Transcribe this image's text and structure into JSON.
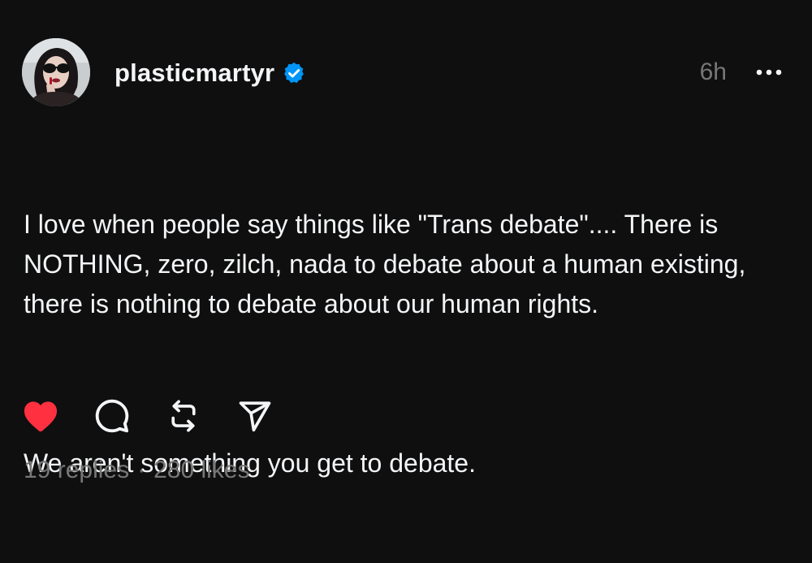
{
  "post": {
    "author": {
      "username": "plasticmartyr",
      "verified": true,
      "verified_color": "#0095f6"
    },
    "timestamp": "6h",
    "text": [
      "I love when people say things like \"Trans debate\".... There is NOTHING, zero, zilch, nada to debate about a human existing, there is nothing to debate about our human rights.",
      "We aren't something you get to debate."
    ],
    "liked": true,
    "like_color": "#ff3040",
    "stats": {
      "replies": "19 replies",
      "separator": "·",
      "likes": "280 likes"
    }
  },
  "icons": {
    "more": "more-horizontal-icon",
    "like": "heart-filled-icon",
    "reply": "comment-bubble-icon",
    "repost": "repost-icon",
    "share": "send-icon",
    "verified": "verified-badge-icon"
  }
}
